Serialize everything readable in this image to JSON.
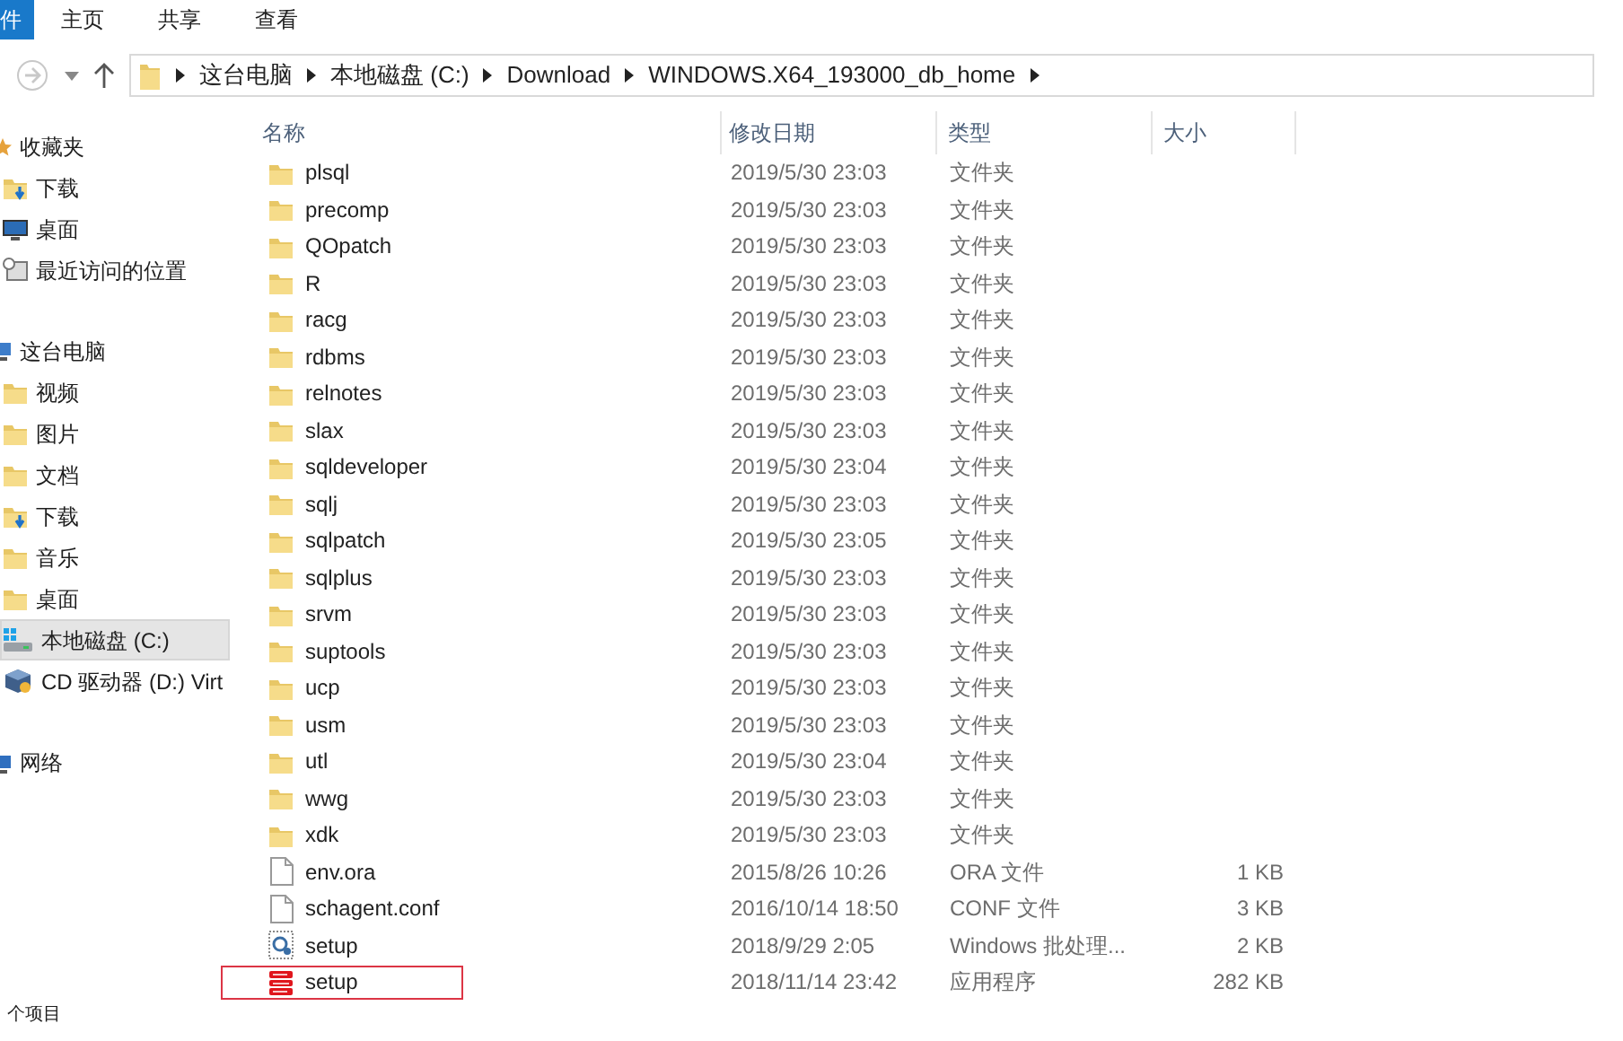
{
  "ribbon": {
    "tabs": [
      {
        "label": "件",
        "selected": true
      },
      {
        "label": "主页",
        "selected": false
      },
      {
        "label": "共享",
        "selected": false
      },
      {
        "label": "查看",
        "selected": false
      }
    ]
  },
  "address_bar": {
    "path": [
      "这台电脑",
      "本地磁盘 (C:)",
      "Download",
      "WINDOWS.X64_193000_db_home"
    ]
  },
  "sidebar": {
    "groups": [
      {
        "label": "收藏夹",
        "kind": "favorites",
        "items": [
          {
            "label": "下载",
            "kind": "download",
            "selected": false
          },
          {
            "label": "桌面",
            "kind": "desktop",
            "selected": false
          },
          {
            "label": "最近访问的位置",
            "kind": "recent",
            "selected": false
          }
        ]
      },
      {
        "label": "这台电脑",
        "kind": "computer",
        "items": [
          {
            "label": "视频",
            "kind": "folder",
            "selected": false
          },
          {
            "label": "图片",
            "kind": "folder",
            "selected": false
          },
          {
            "label": "文档",
            "kind": "folder",
            "selected": false
          },
          {
            "label": "下载",
            "kind": "download",
            "selected": false
          },
          {
            "label": "音乐",
            "kind": "folder",
            "selected": false
          },
          {
            "label": "桌面",
            "kind": "folder",
            "selected": false
          },
          {
            "label": "本地磁盘 (C:)",
            "kind": "drive",
            "selected": true
          },
          {
            "label": "CD 驱动器 (D:) Virt",
            "kind": "cd",
            "selected": false
          }
        ]
      },
      {
        "label": "网络",
        "kind": "network"
      }
    ]
  },
  "table": {
    "columns": [
      "名称",
      "修改日期",
      "类型",
      "大小"
    ],
    "rows": [
      {
        "name": "plsql",
        "date": "2019/5/30 23:03",
        "type": "文件夹",
        "kind": "folder",
        "highlighted": false
      },
      {
        "name": "precomp",
        "date": "2019/5/30 23:03",
        "type": "文件夹",
        "kind": "folder",
        "highlighted": false
      },
      {
        "name": "QOpatch",
        "date": "2019/5/30 23:03",
        "type": "文件夹",
        "kind": "folder",
        "highlighted": false
      },
      {
        "name": "R",
        "date": "2019/5/30 23:03",
        "type": "文件夹",
        "kind": "folder",
        "highlighted": false
      },
      {
        "name": "racg",
        "date": "2019/5/30 23:03",
        "type": "文件夹",
        "kind": "folder",
        "highlighted": false
      },
      {
        "name": "rdbms",
        "date": "2019/5/30 23:03",
        "type": "文件夹",
        "kind": "folder",
        "highlighted": false
      },
      {
        "name": "relnotes",
        "date": "2019/5/30 23:03",
        "type": "文件夹",
        "kind": "folder",
        "highlighted": false
      },
      {
        "name": "slax",
        "date": "2019/5/30 23:03",
        "type": "文件夹",
        "kind": "folder",
        "highlighted": false
      },
      {
        "name": "sqldeveloper",
        "date": "2019/5/30 23:04",
        "type": "文件夹",
        "kind": "folder",
        "highlighted": false
      },
      {
        "name": "sqlj",
        "date": "2019/5/30 23:03",
        "type": "文件夹",
        "kind": "folder",
        "highlighted": false
      },
      {
        "name": "sqlpatch",
        "date": "2019/5/30 23:05",
        "type": "文件夹",
        "kind": "folder",
        "highlighted": false
      },
      {
        "name": "sqlplus",
        "date": "2019/5/30 23:03",
        "type": "文件夹",
        "kind": "folder",
        "highlighted": false
      },
      {
        "name": "srvm",
        "date": "2019/5/30 23:03",
        "type": "文件夹",
        "kind": "folder",
        "highlighted": false
      },
      {
        "name": "suptools",
        "date": "2019/5/30 23:03",
        "type": "文件夹",
        "kind": "folder",
        "highlighted": false
      },
      {
        "name": "ucp",
        "date": "2019/5/30 23:03",
        "type": "文件夹",
        "kind": "folder",
        "highlighted": false
      },
      {
        "name": "usm",
        "date": "2019/5/30 23:03",
        "type": "文件夹",
        "kind": "folder",
        "highlighted": false
      },
      {
        "name": "utl",
        "date": "2019/5/30 23:04",
        "type": "文件夹",
        "kind": "folder",
        "highlighted": false
      },
      {
        "name": "wwg",
        "date": "2019/5/30 23:03",
        "type": "文件夹",
        "kind": "folder",
        "highlighted": false
      },
      {
        "name": "xdk",
        "date": "2019/5/30 23:03",
        "type": "文件夹",
        "kind": "folder",
        "highlighted": false
      },
      {
        "name": "env.ora",
        "date": "2015/8/26 10:26",
        "type": "ORA 文件",
        "size": "1 KB",
        "kind": "file",
        "highlighted": false
      },
      {
        "name": "schagent.conf",
        "date": "2016/10/14 18:50",
        "type": "CONF 文件",
        "size": "3 KB",
        "kind": "file",
        "highlighted": false
      },
      {
        "name": "setup",
        "date": "2018/9/29 2:05",
        "type": "Windows 批处理...",
        "size": "2 KB",
        "kind": "batch",
        "highlighted": false
      },
      {
        "name": "setup",
        "date": "2018/11/14 23:42",
        "type": "应用程序",
        "size": "282 KB",
        "kind": "app",
        "highlighted": true
      }
    ]
  },
  "status_bar": {
    "text": "个项目"
  }
}
